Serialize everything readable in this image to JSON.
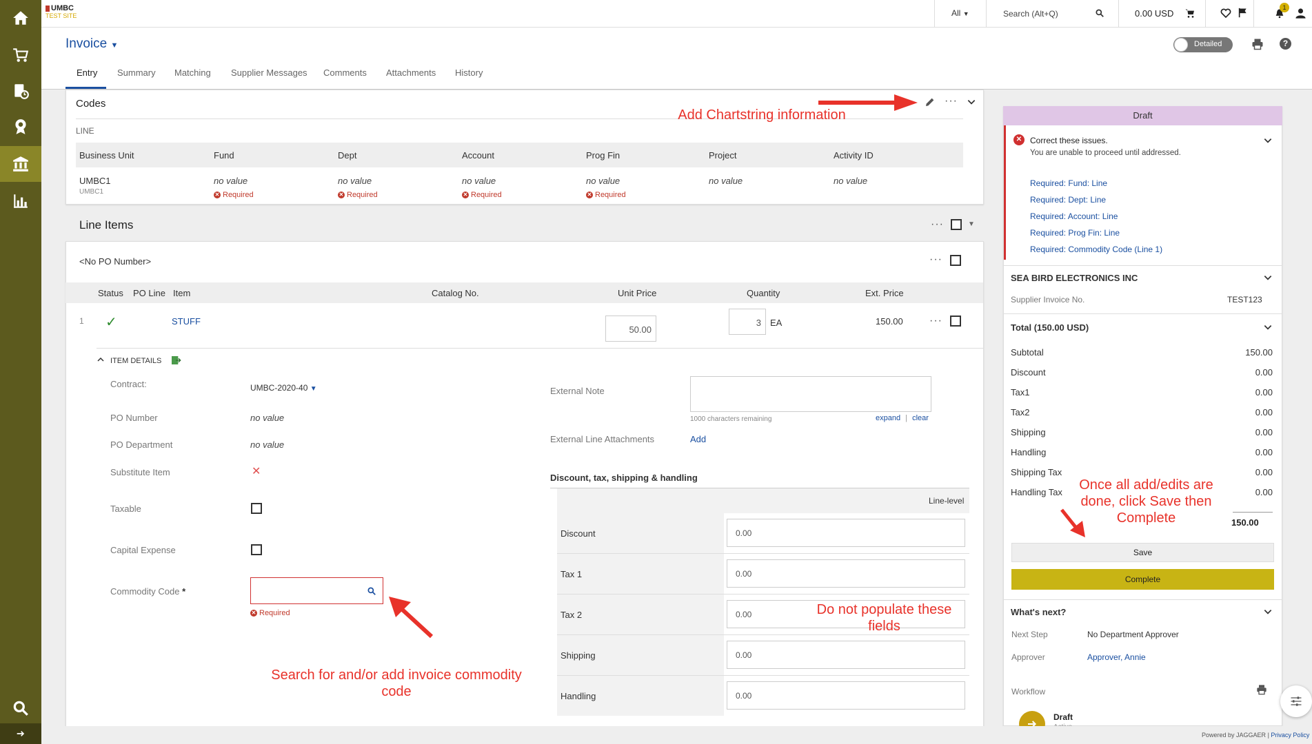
{
  "brand": {
    "logo": "UMBC",
    "site": "TEST SITE"
  },
  "rail": {
    "icons": [
      "home-icon",
      "cart-icon",
      "orders-icon",
      "badge-icon",
      "bank-icon",
      "chart-icon",
      "search-icon",
      "expand-arrow-icon"
    ]
  },
  "topbar": {
    "scope": "All",
    "search_placeholder": "Search (Alt+Q)",
    "cart_total": "0.00 USD",
    "notif_count": "1"
  },
  "header": {
    "title": "Invoice",
    "toggle_label": "Detailed"
  },
  "tabs": [
    "Entry",
    "Summary",
    "Matching",
    "Supplier Messages",
    "Comments",
    "Attachments",
    "History"
  ],
  "codes": {
    "title": "Codes",
    "section": "LINE",
    "columns": [
      "Business Unit",
      "Fund",
      "Dept",
      "Account",
      "Prog Fin",
      "Project",
      "Activity ID"
    ],
    "business_unit": "UMBC1",
    "business_unit_sub": "UMBC1",
    "no_value": "no value",
    "required": "Required"
  },
  "line_items": {
    "title": "Line Items",
    "po": "<No PO Number>",
    "columns": {
      "status": "Status",
      "po_line": "PO Line",
      "item": "Item",
      "catalog": "Catalog No.",
      "unit_price": "Unit Price",
      "quantity": "Quantity",
      "ext_price": "Ext. Price"
    },
    "row": {
      "num": "1",
      "item": "STUFF",
      "unit_price": "50.00",
      "quantity": "3",
      "uom": "EA",
      "ext_price": "150.00"
    },
    "details_label": "ITEM DETAILS",
    "fields": {
      "contract_label": "Contract:",
      "contract_value": "UMBC-2020-40",
      "po_number_label": "PO Number",
      "po_number_value": "no value",
      "po_dept_label": "PO Department",
      "po_dept_value": "no value",
      "substitute_label": "Substitute Item",
      "taxable_label": "Taxable",
      "capital_label": "Capital Expense",
      "commodity_label": "Commodity Code",
      "commodity_required": "Required"
    },
    "external_note_label": "External Note",
    "chars_remaining": "1000 characters remaining",
    "expand": "expand",
    "clear": "clear",
    "ext_attach_label": "External Line Attachments",
    "add": "Add",
    "dtsh_title": "Discount, tax, shipping & handling",
    "line_level": "Line-level",
    "dtsh_rows": [
      {
        "label": "Discount",
        "value": "0.00"
      },
      {
        "label": "Tax 1",
        "value": "0.00"
      },
      {
        "label": "Tax 2",
        "value": "0.00"
      },
      {
        "label": "Shipping",
        "value": "0.00"
      },
      {
        "label": "Handling",
        "value": "0.00"
      }
    ]
  },
  "sidebar": {
    "status": "Draft",
    "issues_title": "Correct these issues.",
    "issues_sub": "You are unable to proceed until addressed.",
    "issues": [
      "Required: Fund: Line",
      "Required: Dept: Line",
      "Required: Account: Line",
      "Required: Prog Fin: Line",
      "Required: Commodity Code (Line 1)"
    ],
    "supplier": "SEA BIRD ELECTRONICS INC",
    "supplier_inv_label": "Supplier Invoice No.",
    "supplier_inv_value": "TEST123",
    "total_title": "Total (150.00 USD)",
    "totals": [
      {
        "label": "Subtotal",
        "value": "150.00"
      },
      {
        "label": "Discount",
        "value": "0.00"
      },
      {
        "label": "Tax1",
        "value": "0.00"
      },
      {
        "label": "Tax2",
        "value": "0.00"
      },
      {
        "label": "Shipping",
        "value": "0.00"
      },
      {
        "label": "Handling",
        "value": "0.00"
      },
      {
        "label": "Shipping Tax",
        "value": "0.00"
      },
      {
        "label": "Handling Tax",
        "value": "0.00"
      }
    ],
    "grand_total": "150.00",
    "save": "Save",
    "complete": "Complete",
    "whats_next": "What's next?",
    "next_step_label": "Next Step",
    "next_step_value": "No Department Approver",
    "approver_label": "Approver",
    "approver_value": "Approver, Annie",
    "workflow_label": "Workflow",
    "workflow_step": "Draft",
    "workflow_sub": "Active"
  },
  "annotations": {
    "chartstring": "Add Chartstring information",
    "save_complete": "Once all add/edits are done, click Save then Complete",
    "do_not_populate": "Do not populate these fields",
    "commodity": "Search for and/or add invoice commodity code"
  },
  "footer": {
    "powered": "Powered by JAGGAER",
    "sep": "|",
    "privacy": "Privacy Policy"
  },
  "colors": {
    "rail": "#5c5a1e",
    "rail_active": "#8a8628",
    "complete": "#c8b414",
    "draft_header": "#e0c6e6",
    "error": "#c0392b",
    "link": "#1a4fa0",
    "annotation": "#e8322a"
  }
}
